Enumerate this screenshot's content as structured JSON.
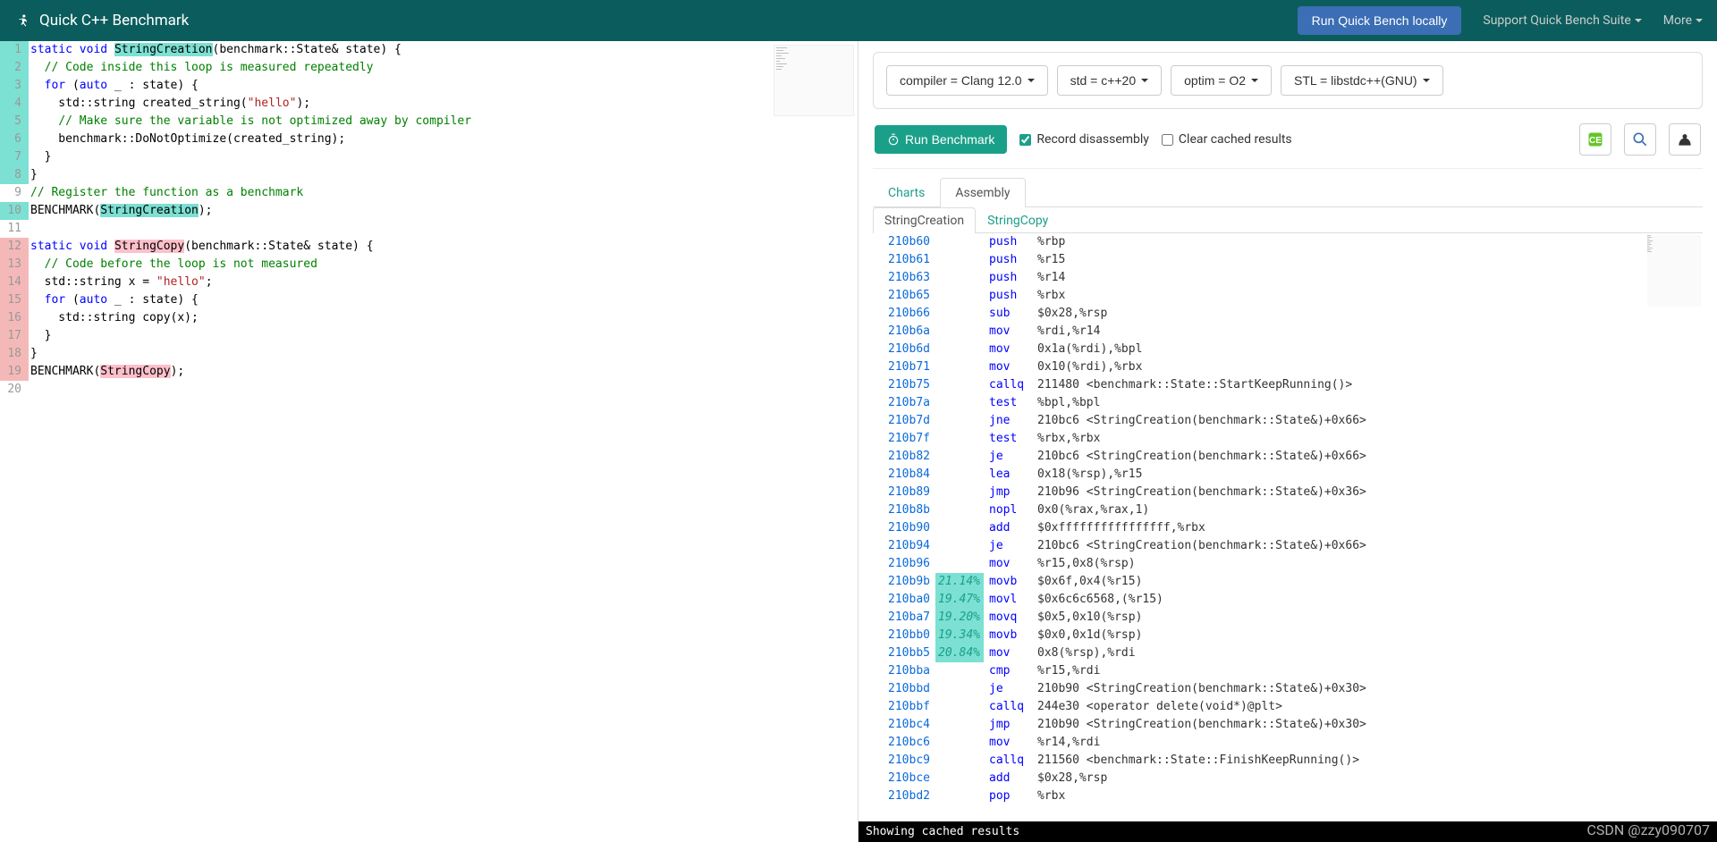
{
  "header": {
    "title": "Quick C++ Benchmark",
    "run_locally": "Run Quick Bench locally",
    "support": "Support Quick Bench Suite",
    "more": "More"
  },
  "editor": {
    "lines": [
      {
        "n": 1,
        "hl": "cyan",
        "html": "<span class='kw'>static</span> <span class='kw'>void</span> <span class='hl-fn1'>StringCreation</span>(benchmark::State&amp; state) {"
      },
      {
        "n": 2,
        "hl": "cyan",
        "html": "  <span class='com'>// Code inside this loop is measured repeatedly</span>"
      },
      {
        "n": 3,
        "hl": "cyan",
        "html": "  <span class='kw'>for</span> (<span class='kw'>auto</span> _ : state) {"
      },
      {
        "n": 4,
        "hl": "cyan",
        "html": "    std::string created_string(<span class='str'>\"hello\"</span>);"
      },
      {
        "n": 5,
        "hl": "cyan",
        "html": "    <span class='com'>// Make sure the variable is not optimized away by compiler</span>"
      },
      {
        "n": 6,
        "hl": "cyan",
        "html": "    benchmark::DoNotOptimize(created_string);"
      },
      {
        "n": 7,
        "hl": "cyan",
        "html": "  }"
      },
      {
        "n": 8,
        "hl": "cyan",
        "html": "}"
      },
      {
        "n": 9,
        "html": "<span class='com'>// Register the function as a benchmark</span>"
      },
      {
        "n": 10,
        "hl": "cyan",
        "html": "BENCHMARK(<span class='hl-fn1'>StringCreation</span>);"
      },
      {
        "n": 11,
        "html": ""
      },
      {
        "n": 12,
        "hl": "red",
        "html": "<span class='kw'>static</span> <span class='kw'>void</span> <span class='hl-fn2'>StringCopy</span>(benchmark::State&amp; state) {"
      },
      {
        "n": 13,
        "hl": "red",
        "html": "  <span class='com'>// Code before the loop is not measured</span>"
      },
      {
        "n": 14,
        "hl": "red",
        "html": "  std::string x = <span class='str'>\"hello\"</span>;"
      },
      {
        "n": 15,
        "hl": "red",
        "html": "  <span class='kw'>for</span> (<span class='kw'>auto</span> _ : state) {"
      },
      {
        "n": 16,
        "hl": "red",
        "html": "    std::string copy(x);"
      },
      {
        "n": 17,
        "hl": "red",
        "html": "  }"
      },
      {
        "n": 18,
        "hl": "red",
        "html": "}"
      },
      {
        "n": 19,
        "hl": "red",
        "html": "BENCHMARK(<span class='hl-fn2'>StringCopy</span>);"
      },
      {
        "n": 20,
        "html": ""
      }
    ]
  },
  "options": {
    "compiler": "compiler = Clang 12.0",
    "std": "std = c++20",
    "optim": "optim = O2",
    "stl": "STL = libstdc++(GNU)"
  },
  "run": {
    "button": "Run Benchmark",
    "record": "Record disassembly",
    "clear": "Clear cached results"
  },
  "tabs": {
    "charts": "Charts",
    "assembly": "Assembly"
  },
  "subtabs": {
    "sc": "StringCreation",
    "scpy": "StringCopy"
  },
  "asm": [
    {
      "addr": "210b60",
      "mn": "push",
      "ops": "%rbp"
    },
    {
      "addr": "210b61",
      "mn": "push",
      "ops": "%r15"
    },
    {
      "addr": "210b63",
      "mn": "push",
      "ops": "%r14"
    },
    {
      "addr": "210b65",
      "mn": "push",
      "ops": "%rbx"
    },
    {
      "addr": "210b66",
      "mn": "sub",
      "ops": "$0x28,%rsp"
    },
    {
      "addr": "210b6a",
      "mn": "mov",
      "ops": "%rdi,%r14"
    },
    {
      "addr": "210b6d",
      "mn": "mov",
      "ops": "0x1a(%rdi),%bpl"
    },
    {
      "addr": "210b71",
      "mn": "mov",
      "ops": "0x10(%rdi),%rbx"
    },
    {
      "addr": "210b75",
      "mn": "callq",
      "ops": "211480 <benchmark::State::StartKeepRunning()>"
    },
    {
      "addr": "210b7a",
      "mn": "test",
      "ops": "%bpl,%bpl"
    },
    {
      "addr": "210b7d",
      "mn": "jne",
      "ops": "210bc6 <StringCreation(benchmark::State&)+0x66>"
    },
    {
      "addr": "210b7f",
      "mn": "test",
      "ops": "%rbx,%rbx"
    },
    {
      "addr": "210b82",
      "mn": "je",
      "ops": "210bc6 <StringCreation(benchmark::State&)+0x66>"
    },
    {
      "addr": "210b84",
      "mn": "lea",
      "ops": "0x18(%rsp),%r15"
    },
    {
      "addr": "210b89",
      "mn": "jmp",
      "ops": "210b96 <StringCreation(benchmark::State&)+0x36>"
    },
    {
      "addr": "210b8b",
      "mn": "nopl",
      "ops": "0x0(%rax,%rax,1)"
    },
    {
      "addr": "210b90",
      "mn": "add",
      "ops": "$0xffffffffffffffff,%rbx"
    },
    {
      "addr": "210b94",
      "mn": "je",
      "ops": "210bc6 <StringCreation(benchmark::State&)+0x66>"
    },
    {
      "addr": "210b96",
      "mn": "mov",
      "ops": "%r15,0x8(%rsp)"
    },
    {
      "addr": "210b9b",
      "pct": "21.14%",
      "mn": "movb",
      "ops": "$0x6f,0x4(%r15)"
    },
    {
      "addr": "210ba0",
      "pct": "19.47%",
      "mn": "movl",
      "ops": "$0x6c6c6568,(%r15)"
    },
    {
      "addr": "210ba7",
      "pct": "19.20%",
      "mn": "movq",
      "ops": "$0x5,0x10(%rsp)"
    },
    {
      "addr": "210bb0",
      "pct": "19.34%",
      "mn": "movb",
      "ops": "$0x0,0x1d(%rsp)"
    },
    {
      "addr": "210bb5",
      "pct": "20.84%",
      "mn": "mov",
      "ops": "0x8(%rsp),%rdi"
    },
    {
      "addr": "210bba",
      "mn": "cmp",
      "ops": "%r15,%rdi"
    },
    {
      "addr": "210bbd",
      "mn": "je",
      "ops": "210b90 <StringCreation(benchmark::State&)+0x30>"
    },
    {
      "addr": "210bbf",
      "mn": "callq",
      "ops": "244e30 <operator delete(void*)@plt>"
    },
    {
      "addr": "210bc4",
      "mn": "jmp",
      "ops": "210b90 <StringCreation(benchmark::State&)+0x30>"
    },
    {
      "addr": "210bc6",
      "mn": "mov",
      "ops": "%r14,%rdi"
    },
    {
      "addr": "210bc9",
      "mn": "callq",
      "ops": "211560 <benchmark::State::FinishKeepRunning()>"
    },
    {
      "addr": "210bce",
      "mn": "add",
      "ops": "$0x28,%rsp"
    },
    {
      "addr": "210bd2",
      "mn": "pop",
      "ops": "%rbx"
    }
  ],
  "status": "Showing cached results",
  "watermark": "CSDN @zzy090707"
}
